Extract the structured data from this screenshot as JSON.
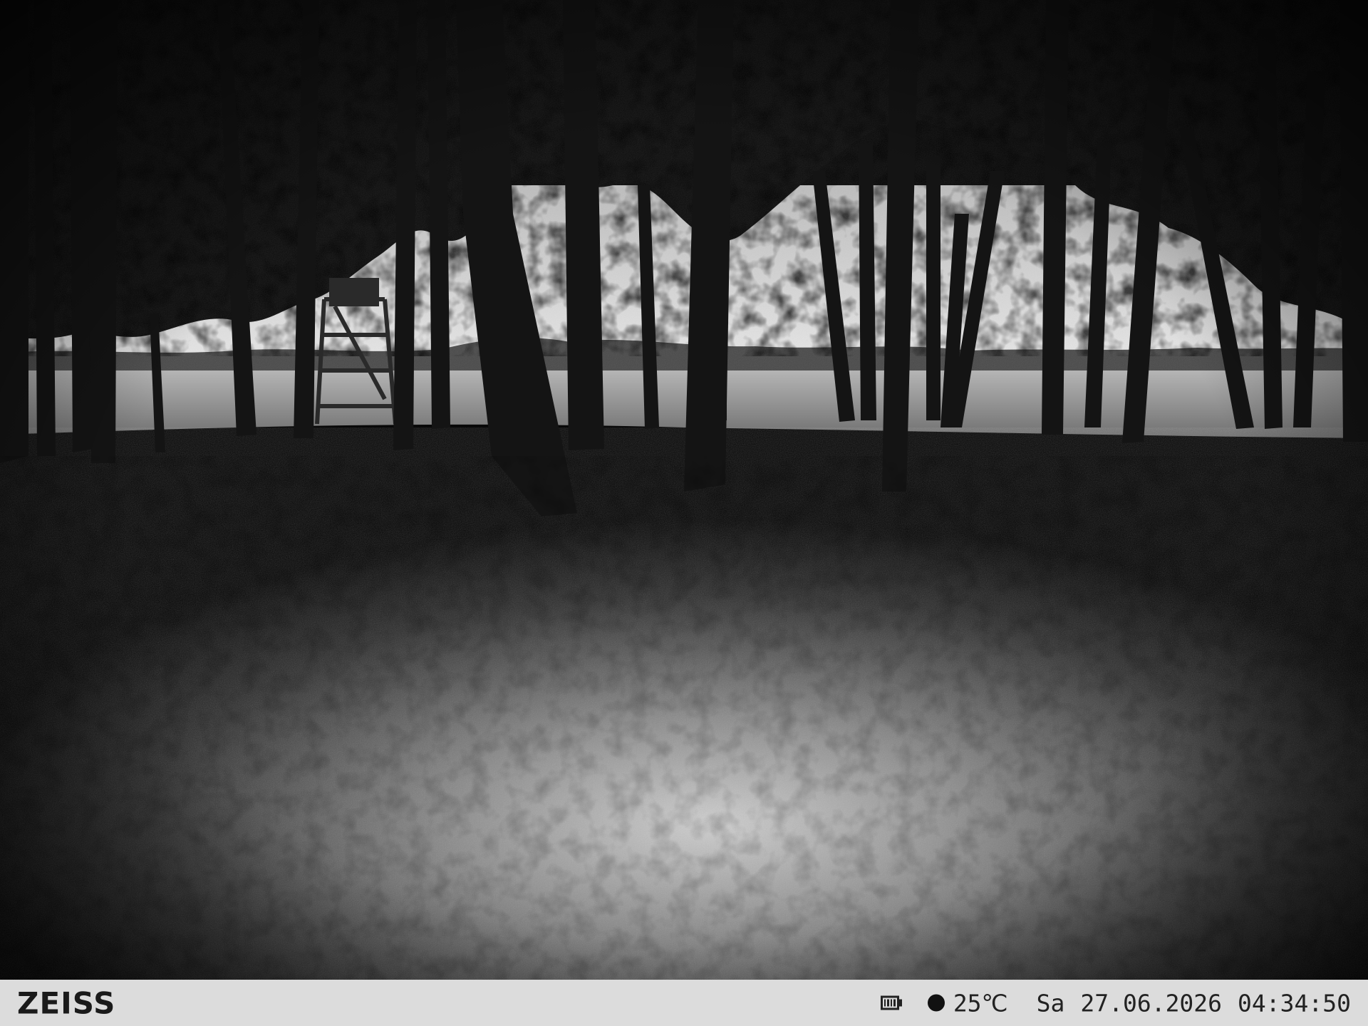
{
  "camera": {
    "brand": "ZEISS",
    "battery_icon": "battery-full-icon",
    "moon_icon": "moon-phase-icon",
    "temperature": "25℃",
    "weekday": "Sa",
    "date": "27.06.2026",
    "time": "04:34:50"
  },
  "scene": {
    "description_icon": "forest-night-photo"
  }
}
